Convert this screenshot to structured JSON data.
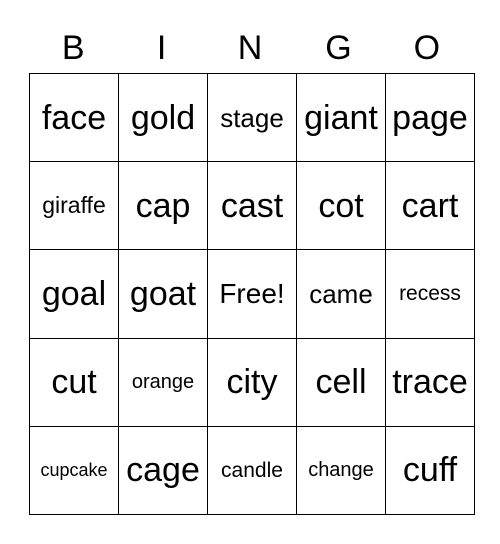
{
  "header": [
    "B",
    "I",
    "N",
    "G",
    "O"
  ],
  "rows": [
    [
      "face",
      "gold",
      "stage",
      "giant",
      "page"
    ],
    [
      "giraffe",
      "cap",
      "cast",
      "cot",
      "cart"
    ],
    [
      "goal",
      "goat",
      "Free!",
      "came",
      "recess"
    ],
    [
      "cut",
      "orange",
      "city",
      "cell",
      "trace"
    ],
    [
      "cupcake",
      "cage",
      "candle",
      "change",
      "cuff"
    ]
  ]
}
